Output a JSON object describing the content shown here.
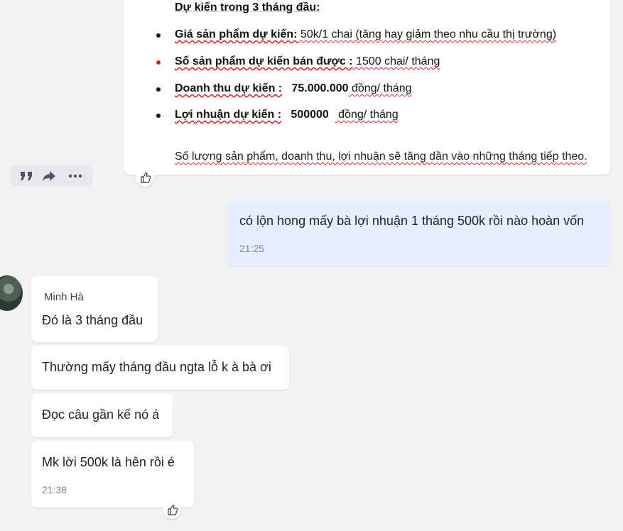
{
  "document_message": {
    "heading": "Dự kiến trong 3 tháng đầu:",
    "items": [
      {
        "key": "Giá sản phẩm dự kiến:",
        "value": " 50k/1 chai (tăng hay giảm theo nhu cầu thị trường)",
        "bullet_color": "#111111"
      },
      {
        "key": "Số sản phẩm dự kiến bán được :",
        "value": " 1500 chai/ tháng",
        "bullet_color": "#e21d1d"
      },
      {
        "key": "Doanh thu dự kiến :",
        "mid": "75.000.000",
        "value": " đồng/ tháng",
        "bullet_color": "#111111"
      },
      {
        "key": "Lợi nhuận dự kiến :",
        "mid": "500000",
        "value": " đồng/ tháng",
        "bullet_color": "#111111"
      }
    ],
    "note": "Số lượng sản phẩm, doanh thu, lợi nhuận sẽ tăng dần vào những tháng tiếp theo."
  },
  "message_actions": {
    "icons": [
      "quote-icon",
      "forward-icon",
      "more-icon"
    ]
  },
  "outgoing_message": {
    "text": "có lộn hong mấy bà lợi nhuận 1 tháng 500k rồi nào hoàn vốn",
    "time": "21:25"
  },
  "incoming_group": {
    "sender": "Minh Hà",
    "messages": [
      {
        "text": "Đó là 3 tháng đầu"
      },
      {
        "text": "Thường mấy tháng đầu ngta lỗ k à bà ơi"
      },
      {
        "text": "Đọc câu gần kế nó á"
      },
      {
        "text": "Mk lời 500k là hên rồi é",
        "time": "21:38"
      }
    ]
  },
  "colors": {
    "background": "#f1f2f4",
    "outgoing_bubble": "#e5efff",
    "incoming_bubble": "#ffffff",
    "spellcheck_underline": "#d9262a"
  }
}
